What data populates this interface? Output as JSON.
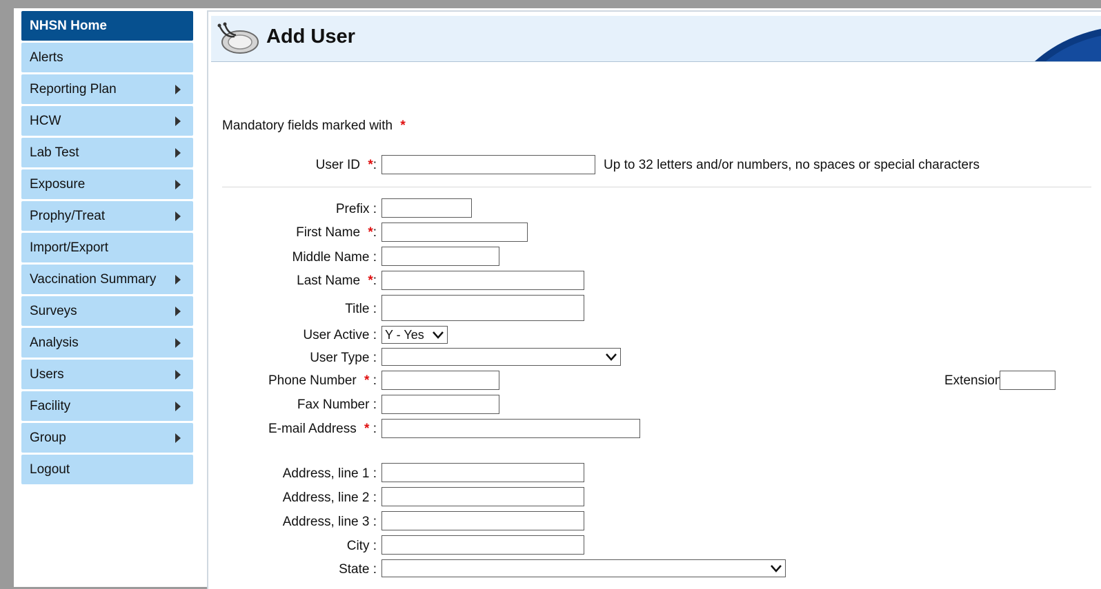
{
  "sidebar": {
    "items": [
      {
        "label": "NHSN Home",
        "arrow": false
      },
      {
        "label": "Alerts",
        "arrow": false
      },
      {
        "label": "Reporting Plan",
        "arrow": true
      },
      {
        "label": "HCW",
        "arrow": true
      },
      {
        "label": "Lab Test",
        "arrow": true
      },
      {
        "label": "Exposure",
        "arrow": true
      },
      {
        "label": "Prophy/Treat",
        "arrow": true
      },
      {
        "label": "Import/Export",
        "arrow": false
      },
      {
        "label": "Vaccination Summary",
        "arrow": true
      },
      {
        "label": "Surveys",
        "arrow": true
      },
      {
        "label": "Analysis",
        "arrow": true
      },
      {
        "label": "Users",
        "arrow": true
      },
      {
        "label": "Facility",
        "arrow": true
      },
      {
        "label": "Group",
        "arrow": true
      },
      {
        "label": "Logout",
        "arrow": false
      }
    ]
  },
  "header": {
    "title": "Add User"
  },
  "form": {
    "mandatory_note": "Mandatory fields marked with",
    "required_marker": "*",
    "user_id_label": "User ID",
    "user_id_hint": "Up to 32 letters and/or numbers, no spaces or special characters",
    "prefix_label": "Prefix :",
    "first_name_label": "First Name",
    "middle_name_label": "Middle Name :",
    "last_name_label": "Last Name",
    "title_label": "Title :",
    "user_active_label": "User Active :",
    "user_active_value": "Y - Yes",
    "user_type_label": "User Type :",
    "user_type_value": "",
    "phone_label": "Phone Number",
    "extension_label": "Extension :",
    "fax_label": "Fax Number :",
    "email_label": "E-mail Address",
    "address1_label": "Address, line 1 :",
    "address2_label": "Address, line 2 :",
    "address3_label": "Address, line 3 :",
    "city_label": "City :",
    "state_label": "State :",
    "state_value": ""
  },
  "colors": {
    "nav_home_bg": "#06508f",
    "nav_item_bg": "#b3dbf7",
    "header_bg": "#e6f1fb",
    "required": "#e01010"
  }
}
